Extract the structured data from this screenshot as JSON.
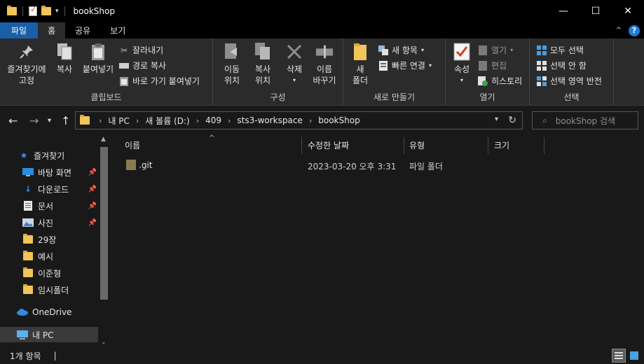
{
  "window": {
    "title": "bookShop",
    "controls": [
      "—",
      "☐",
      "✕"
    ]
  },
  "tabs": [
    "파일",
    "홈",
    "공유",
    "보기"
  ],
  "ribbon": {
    "clipboard": {
      "label": "클립보드",
      "pin_label": "즐겨찾기에\n고정",
      "copy_label": "복사",
      "paste_label": "붙여넣기",
      "cut_label": "잘라내기",
      "copy_path_label": "경로 복사",
      "paste_shortcut_label": "바로 가기 붙여넣기"
    },
    "organize": {
      "label": "구성",
      "move_to_label": "이동\n위치",
      "copy_to_label": "복사\n위치",
      "delete_label": "삭제",
      "rename_label": "이름\n바꾸기"
    },
    "new": {
      "label": "새로 만들기",
      "new_folder_label": "새\n폴더",
      "new_item_label": "새 항목",
      "easy_access_label": "빠른 연결"
    },
    "open": {
      "label": "열기",
      "properties_label": "속성",
      "open_label": "열기",
      "edit_label": "편집",
      "history_label": "히스토리"
    },
    "select": {
      "label": "선택",
      "select_all_label": "모두 선택",
      "select_none_label": "선택 안 함",
      "invert_label": "선택 영역 반전"
    }
  },
  "address": {
    "crumbs": [
      "내 PC",
      "새 볼륨 (D:)",
      "409",
      "sts3-workspace",
      "bookShop"
    ],
    "search_placeholder": "bookShop 검색"
  },
  "nav": {
    "quick_access": "즐겨찾기",
    "items": [
      {
        "label": "바탕 화면",
        "icon": "desktop-icon",
        "pinned": true
      },
      {
        "label": "다운로드",
        "icon": "download-icon",
        "pinned": true
      },
      {
        "label": "문서",
        "icon": "document-icon",
        "pinned": true
      },
      {
        "label": "사진",
        "icon": "pictures-icon",
        "pinned": true
      },
      {
        "label": "29장",
        "icon": "folder-icon",
        "pinned": false
      },
      {
        "label": "예시",
        "icon": "folder-icon",
        "pinned": false
      },
      {
        "label": "이준형",
        "icon": "folder-icon",
        "pinned": false
      },
      {
        "label": "임시폴더",
        "icon": "folder-icon",
        "pinned": false
      }
    ],
    "onedrive": "OneDrive",
    "this_pc": "내 PC"
  },
  "columns": {
    "name": "이름",
    "modified": "수정한 날짜",
    "type": "유형",
    "size": "크기"
  },
  "files": [
    {
      "name": ".git",
      "modified": "2023-03-20 오후 3:31",
      "type": "파일 폴더",
      "size": ""
    }
  ],
  "status": {
    "count": "1개 항목",
    "cursor": "|"
  },
  "colors": {
    "file_tab": "#1a5ea8",
    "folder": "#f2c45a",
    "background": "#191919",
    "ribbon": "#2b2b2b"
  }
}
